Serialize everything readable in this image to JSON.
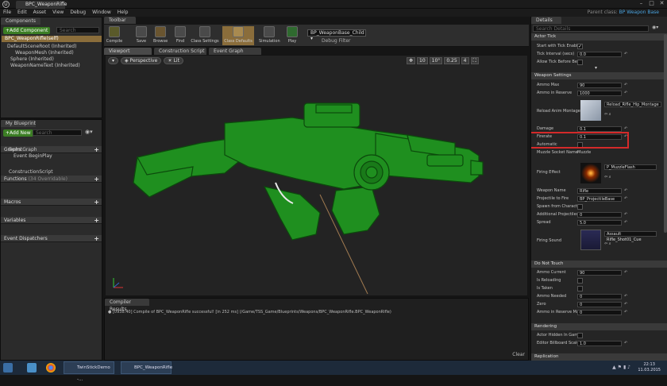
{
  "window": {
    "doc_tab": "BPC_WeaponRifle",
    "parent_class_label": "Parent class:",
    "parent_class_value": "BP Weapon Base"
  },
  "menu": [
    "File",
    "Edit",
    "Asset",
    "View",
    "Debug",
    "Window",
    "Help"
  ],
  "components": {
    "tab": "Components",
    "add_button": "+Add Component",
    "search_placeholder": "Search",
    "self_item": "BPC_WeaponRifle(self)",
    "tree": [
      "DefaultSceneRoot (Inherited)",
      "WeaponMesh (Inherited)",
      "Sphere (Inherited)",
      "WeaponNameText (Inherited)"
    ]
  },
  "myblueprint": {
    "tab": "My Blueprint",
    "add_button": "+Add New",
    "search_placeholder": "Search",
    "graphs_label": "Graphs",
    "graph_items": [
      "EventGraph",
      "Event BeginPlay"
    ],
    "functions_label": "Functions",
    "functions_count": "(34 Overridable)",
    "function_items": [
      "ConstructionScript"
    ],
    "macros_label": "Macros",
    "variables_label": "Variables",
    "dispatchers_label": "Event Dispatchers"
  },
  "toolbar": {
    "tab": "Toolbar",
    "buttons": [
      "Compile",
      "Save",
      "Browse",
      "Find",
      "Class Settings",
      "Class Defaults",
      "Simulation",
      "Play"
    ],
    "debug_object": "BP_WeaponBase_Child",
    "debug_filter": "Debug Filter"
  },
  "editor_tabs": [
    "Viewport",
    "Construction Script",
    "Event Graph"
  ],
  "viewport": {
    "perspective": "Perspective",
    "lit": "Lit",
    "grid": "10",
    "angle": "10°",
    "scale": "0.25",
    "cam_speed": "4"
  },
  "compiler": {
    "tab": "Compiler Results",
    "message": "[0938.40] Compile of BPC_WeaponRifle successful! [in 252 ms] (/Game/TSS_Game/Blueprints/Weapons/BPC_WeaponRifle.BPC_WeaponRifle)",
    "clear": "Clear"
  },
  "details": {
    "tab": "Details",
    "search_placeholder": "Search Details",
    "actor_tick": "Actor Tick",
    "tick_props": [
      {
        "label": "Start with Tick Enabled",
        "kind": "check",
        "checked": true
      },
      {
        "label": "Tick Interval (secs)",
        "kind": "value",
        "value": "0.0"
      },
      {
        "label": "Allow Tick Before Beg",
        "kind": "check",
        "checked": false
      }
    ],
    "weapon_settings": "Weapon Settings",
    "weapon_props": [
      {
        "label": "Ammo Max",
        "kind": "value",
        "value": "90"
      },
      {
        "label": "Ammo in Reserve",
        "kind": "value",
        "value": "1000"
      }
    ],
    "reload_montage_label": "Reload Anim Montage",
    "reload_montage_value": "Reload_Rifle_Hip_Montage",
    "weapon_props2": [
      {
        "label": "Damage",
        "kind": "value",
        "value": "0.1"
      },
      {
        "label": "Firerate",
        "kind": "value",
        "value": "0.1"
      },
      {
        "label": "Automatic",
        "kind": "check",
        "checked": false
      },
      {
        "label": "Muzzle Socket Name",
        "kind": "text",
        "value": "Muzzle"
      }
    ],
    "firing_effect_label": "Firing Effect",
    "firing_effect_value": "P_MuzzleFlash",
    "weapon_props3": [
      {
        "label": "Weapon Name",
        "kind": "value",
        "value": "Rifle"
      },
      {
        "label": "Projectile to Fire",
        "kind": "value",
        "value": "BP_ProjectileBase"
      },
      {
        "label": "Spawn from Character",
        "kind": "check",
        "checked": false
      },
      {
        "label": "Additional Projectiles t",
        "kind": "value",
        "value": "0"
      },
      {
        "label": "Spread",
        "kind": "value",
        "value": "5.0"
      }
    ],
    "firing_sound_label": "Firing Sound",
    "firing_sound_value": "Assault Rifle_Shot01_Cue",
    "do_not_touch": "Do Not Touch",
    "dnt_props": [
      {
        "label": "Ammo Current",
        "kind": "value",
        "value": "90"
      },
      {
        "label": "Is Reloading",
        "kind": "check",
        "checked": false
      },
      {
        "label": "Is Taken",
        "kind": "check",
        "checked": false
      },
      {
        "label": "Ammo Needed",
        "kind": "value",
        "value": "0"
      },
      {
        "label": "Zero",
        "kind": "value",
        "value": "0"
      },
      {
        "label": "Ammo in Reserve Max",
        "kind": "value",
        "value": "0"
      }
    ],
    "rendering": "Rendering",
    "render_props": [
      {
        "label": "Actor Hidden In Game",
        "kind": "check",
        "checked": false
      },
      {
        "label": "Editor Billboard Scale",
        "kind": "value",
        "value": "1.0"
      }
    ],
    "replication": "Replication"
  },
  "taskbar": {
    "tasks": [
      "TwinStickDemo -...",
      "BPC_WeaponRifle"
    ],
    "clock_time": "22:13",
    "clock_date": "11.03.2015"
  },
  "colors": {
    "gun": "#1f8f1f",
    "highlight": "#d42a2a",
    "accent": "#4aa3df",
    "panel": "#2b2b2b"
  }
}
